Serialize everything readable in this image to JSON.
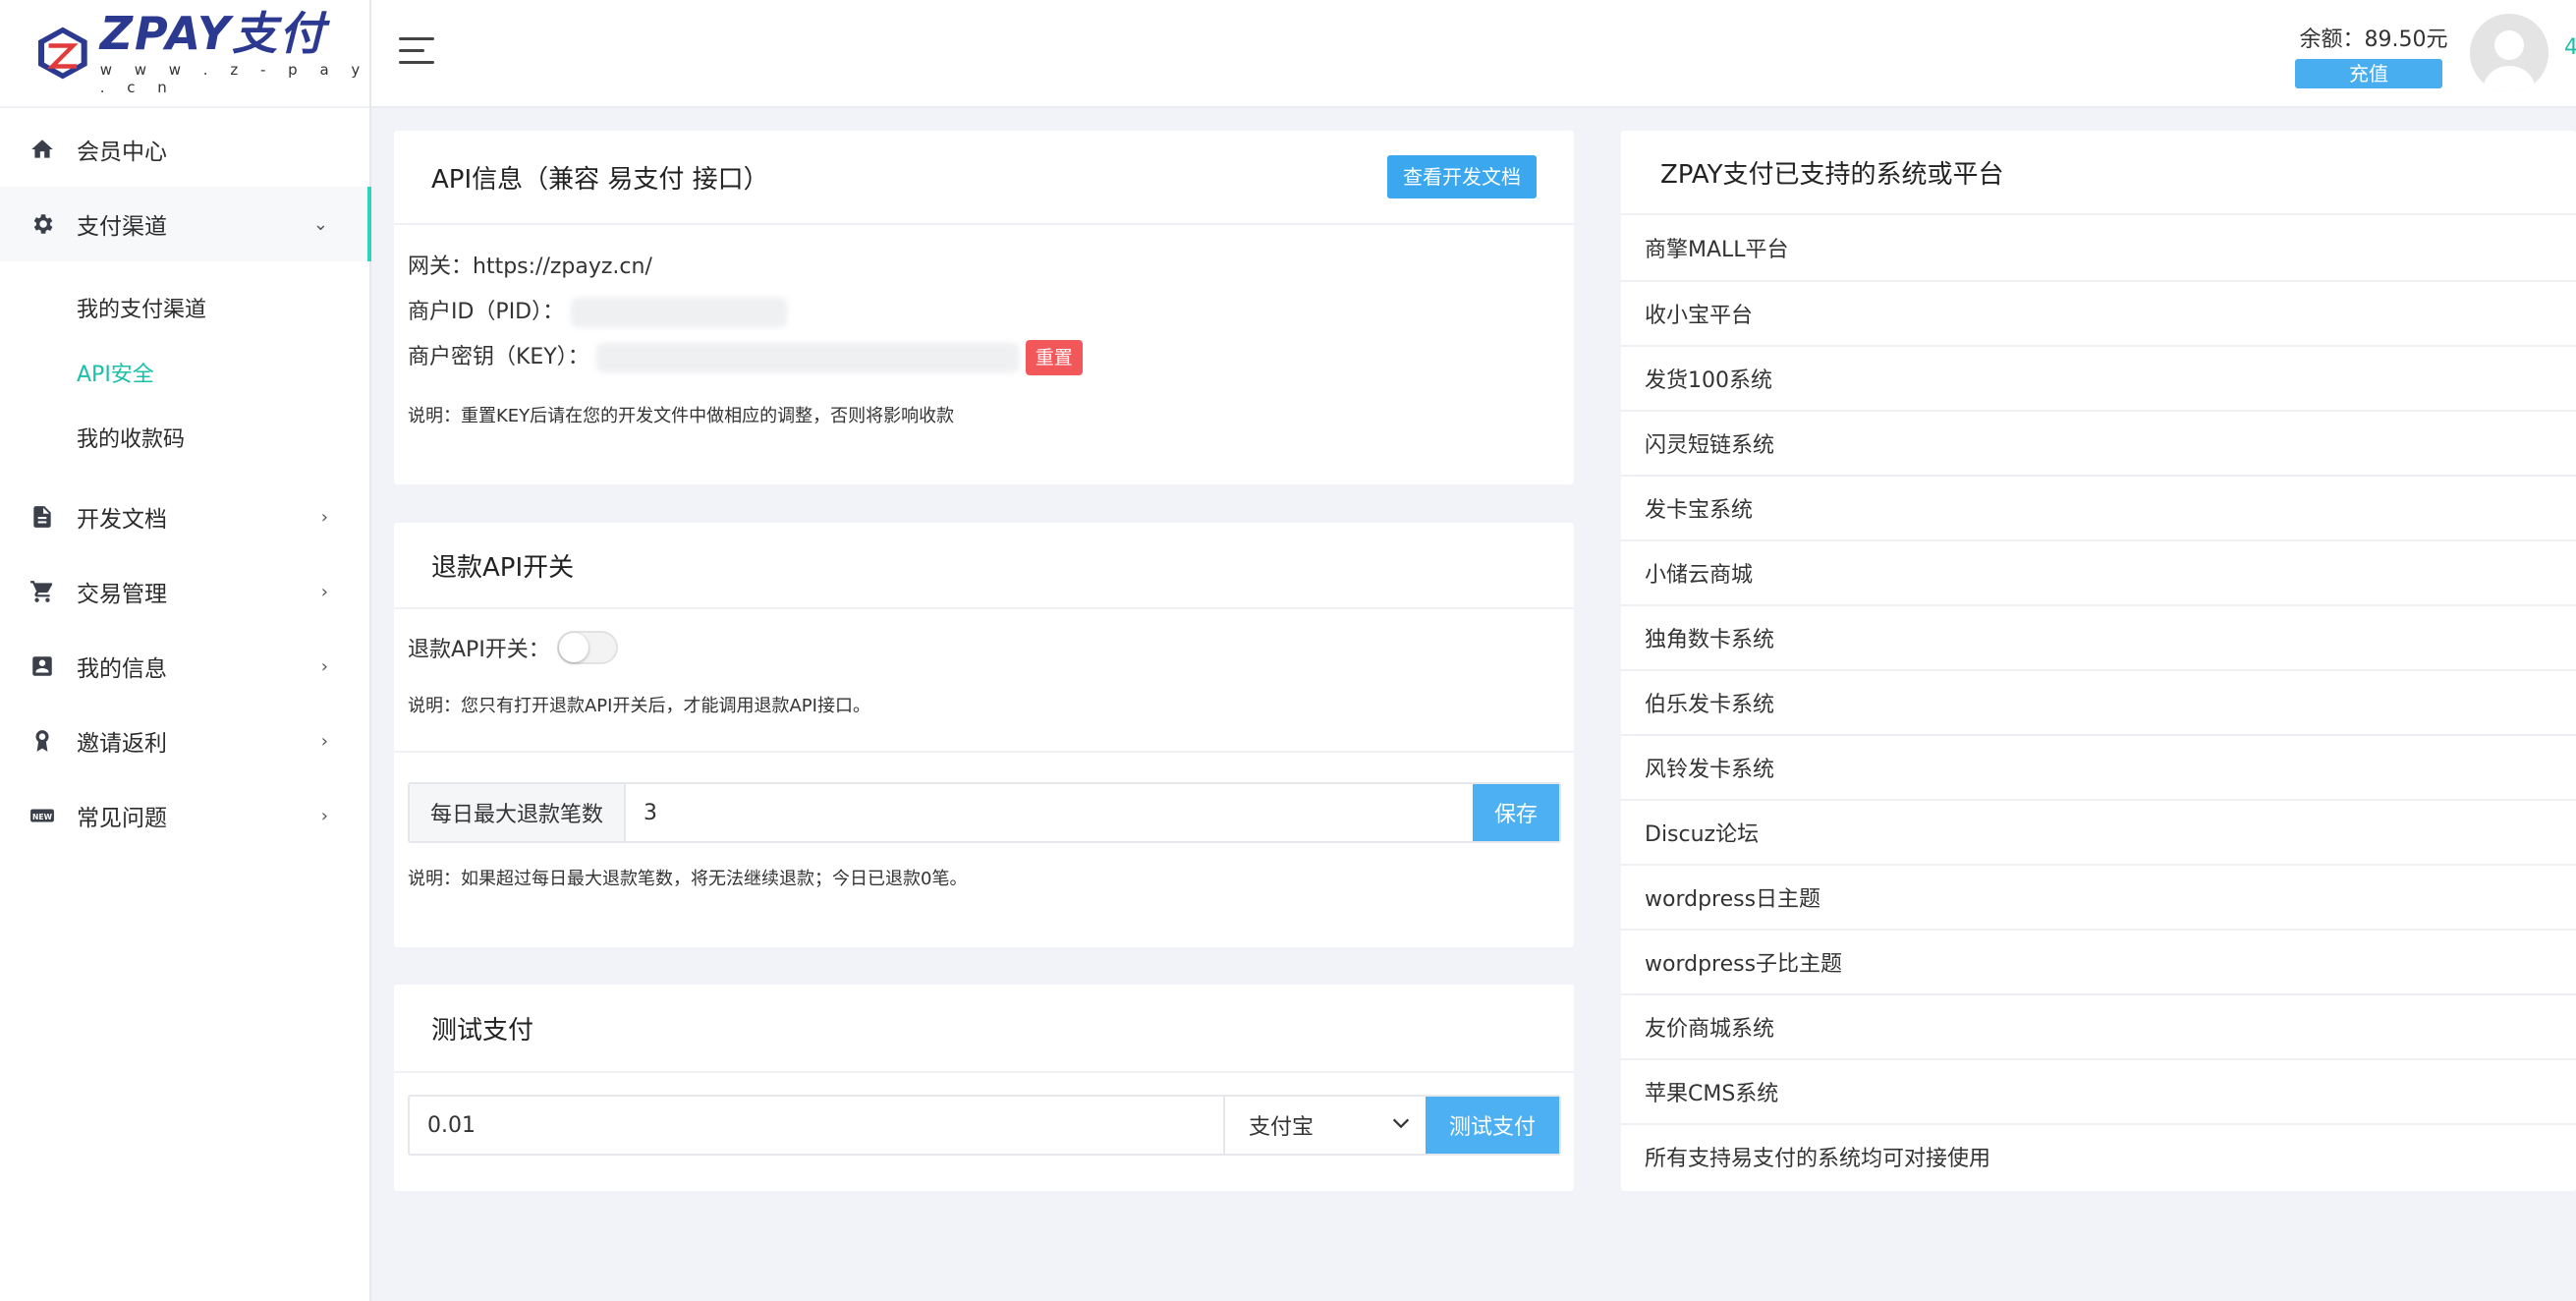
{
  "brand": {
    "name": "ZPAY支付",
    "sub": "w w w . z - p a y . c n"
  },
  "sidebar": {
    "items": [
      {
        "label": "会员中心",
        "icon": "home-icon"
      },
      {
        "label": "支付渠道",
        "icon": "gear-icon"
      },
      {
        "label": "开发文档",
        "icon": "document-icon"
      },
      {
        "label": "交易管理",
        "icon": "cart-icon"
      },
      {
        "label": "我的信息",
        "icon": "contact-card-icon"
      },
      {
        "label": "邀请返利",
        "icon": "badge-icon"
      },
      {
        "label": "常见问题",
        "icon": "new-icon"
      }
    ],
    "sub_items": [
      {
        "label": "我的支付渠道"
      },
      {
        "label": "API安全"
      },
      {
        "label": "我的收款码"
      }
    ]
  },
  "header": {
    "balance_label": "余额：89.50元",
    "recharge_label": "充值",
    "user_number_partial": "4"
  },
  "api_card": {
    "title": "API信息（兼容 易支付 接口）",
    "doc_button": "查看开发文档",
    "gateway": "网关：https://zpayz.cn/",
    "pid_label": "商户ID（PID）：",
    "key_label": "商户密钥（KEY）：",
    "reset_button": "重置",
    "note": "说明：重置KEY后请在您的开发文件中做相应的调整，否则将影响收款"
  },
  "refund_card": {
    "title": "退款API开关",
    "switch_label": "退款API开关：",
    "switch_on": false,
    "note": "说明：您只有打开退款API开关后，才能调用退款API接口。",
    "max_label": "每日最大退款笔数",
    "max_value": "3",
    "save_button": "保存",
    "note2": "说明：如果超过每日最大退款笔数，将无法继续退款；今日已退款0笔。"
  },
  "test_card": {
    "title": "测试支付",
    "amount": "0.01",
    "method": "支付宝",
    "test_button": "测试支付"
  },
  "platforms": {
    "title": "ZPAY支付已支持的系统或平台",
    "items": [
      "商擎MALL平台",
      "收小宝平台",
      "发货100系统",
      "闪灵短链系统",
      "发卡宝系统",
      "小储云商城",
      "独角数卡系统",
      "伯乐发卡系统",
      "风铃发卡系统",
      "Discuz论坛",
      "wordpress日主题",
      "wordpress子比主题",
      "友价商城系统",
      "苹果CMS系统",
      "所有支持易支付的系统均可对接使用"
    ]
  },
  "colors": {
    "accent": "#1bc0a8",
    "primary_button": "#4cb0f2",
    "danger": "#f25759"
  }
}
